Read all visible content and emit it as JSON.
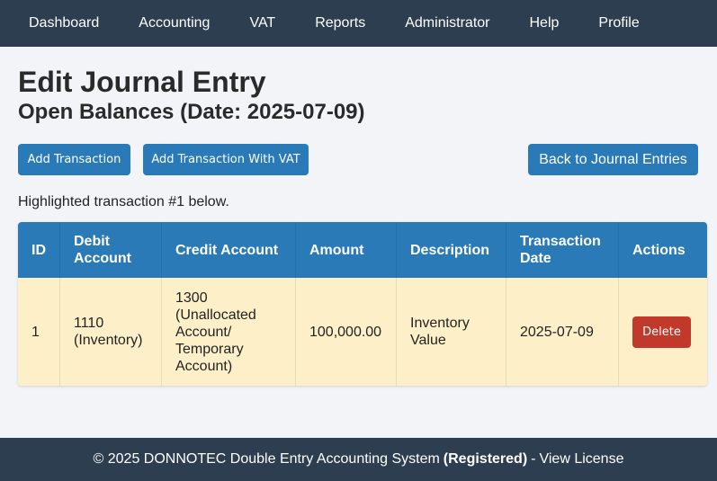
{
  "nav": {
    "items": [
      "Dashboard",
      "Accounting",
      "VAT",
      "Reports",
      "Administrator",
      "Help",
      "Profile"
    ]
  },
  "page": {
    "title": "Edit Journal Entry",
    "subtitle": "Open Balances (Date: 2025-07-09)"
  },
  "buttons": {
    "add_transaction": "Add Transaction",
    "add_transaction_vat": "Add Transaction With VAT",
    "back": "Back to Journal Entries"
  },
  "note": "Highlighted transaction #1 below.",
  "table": {
    "headers": [
      "ID",
      "Debit Account",
      "Credit Account",
      "Amount",
      "Description",
      "Transaction Date",
      "Actions"
    ],
    "rows": [
      {
        "id": "1",
        "debit": "1110 (Inventory)",
        "credit": "1300 (Unallocated Account/ Temporary Account)",
        "amount": "100,000.00",
        "description": "Inventory Value",
        "date": "2025-07-09",
        "action": "Delete"
      }
    ]
  },
  "footer": {
    "copyright": "© 2025 DONNOTEC Double Entry Accounting System",
    "registered": "(Registered)",
    "separator": "-",
    "license_link": "View License"
  },
  "colors": {
    "nav_bg": "#2c3e50",
    "primary": "#2a7ab8",
    "danger": "#c0392b",
    "highlight_row": "#fdf0c8"
  }
}
